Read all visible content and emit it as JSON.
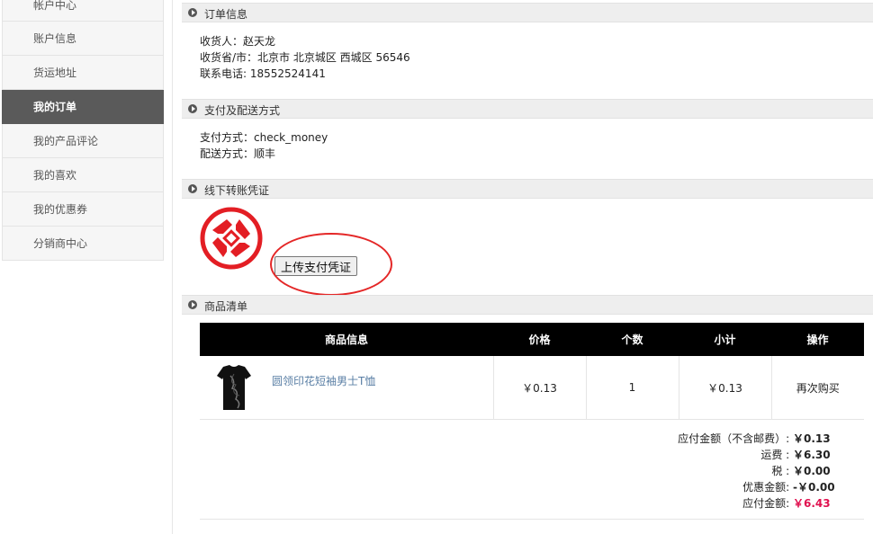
{
  "sidebar": {
    "items": [
      {
        "label": "帐户中心"
      },
      {
        "label": "账户信息"
      },
      {
        "label": "货运地址"
      },
      {
        "label": "我的订单"
      },
      {
        "label": "我的产品评论"
      },
      {
        "label": "我的喜欢"
      },
      {
        "label": "我的优惠券"
      },
      {
        "label": "分销商中心"
      }
    ],
    "active_index": 3
  },
  "order_info": {
    "title": "订单信息",
    "consignee": "收货人：赵天龙",
    "region": "收货省/市：北京市 北京城区 西城区 56546",
    "phone": "联系电话: 18552524141"
  },
  "payment": {
    "title": "支付及配送方式",
    "method": "支付方式：check_money",
    "shipping": "配送方式：顺丰"
  },
  "voucher": {
    "title": "线下转账凭证",
    "upload_label": "上传支付凭证"
  },
  "goods": {
    "title": "商品清单",
    "headers": [
      "商品信息",
      "价格",
      "个数",
      "小计",
      "操作"
    ],
    "rows": [
      {
        "name": "圆领印花短袖男士T恤",
        "price": "￥0.13",
        "qty": "1",
        "subtotal": "￥0.13",
        "action": "再次购买"
      }
    ]
  },
  "summary": {
    "subtotal_label": "应付金额（不含邮费）:",
    "subtotal_value": "￥0.13",
    "shipping_label": "运费 :",
    "shipping_value": "￥6.30",
    "tax_label": "税 :",
    "tax_value": "￥0.00",
    "discount_label": "优惠金额:",
    "discount_value": "-￥0.00",
    "total_label": "应付金额:",
    "total_value": "￥6.43"
  },
  "colors": {
    "accent_red": "#e0114f",
    "highlight_ellipse": "#e42727",
    "active_sidebar": "#5a5a5a",
    "link_blue": "#5a7fa5"
  }
}
